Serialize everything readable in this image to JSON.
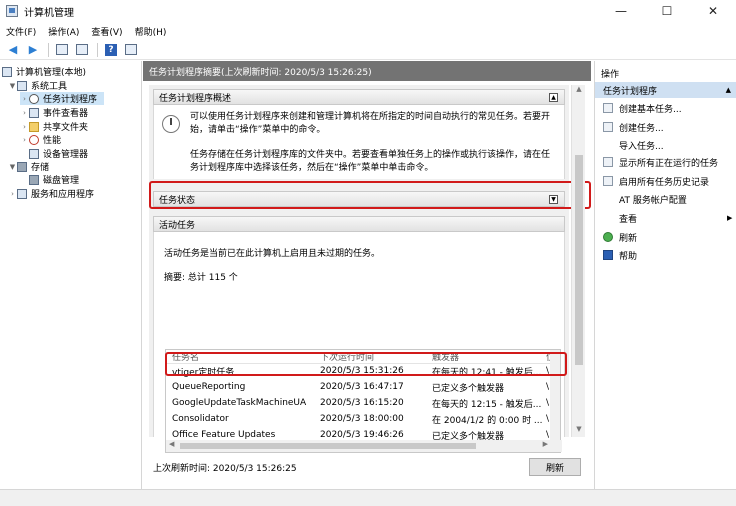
{
  "window": {
    "title": "计算机管理",
    "min": "—",
    "max": "☐",
    "close": "✕"
  },
  "menu": [
    "文件(F)",
    "操作(A)",
    "查看(V)",
    "帮助(H)"
  ],
  "toolbar": {
    "back": "◀",
    "forward": "▶"
  },
  "tree": {
    "root": "计算机管理(本地)",
    "system_tools": "系统工具",
    "task_scheduler": "任务计划程序",
    "event_viewer": "事件查看器",
    "shared_folders": "共享文件夹",
    "performance": "性能",
    "device_manager": "设备管理器",
    "storage": "存储",
    "disk_management": "磁盘管理",
    "services": "服务和应用程序"
  },
  "main": {
    "header": "任务计划程序摘要(上次刷新时间: 2020/5/3 15:26:25)",
    "overview_title": "任务计划程序概述",
    "overview_p1": "可以使用任务计划程序来创建和管理计算机将在所指定的时间自动执行的常见任务。若要开始，请单击“操作”菜单中的命令。",
    "overview_p2": "任务存储在任务计划程序库的文件夹中。若要查看单独任务上的操作或执行该操作，请在任务计划程序库中选择该任务，然后在“操作”菜单中单击命令。",
    "status_title": "任务状态",
    "active_title": "活动任务",
    "active_desc": "活动任务是当前已在此计算机上启用且未过期的任务。",
    "summary": "摘要: 总计 115 个",
    "columns": [
      "任务名",
      "下次运行时间",
      "触发器",
      "位"
    ],
    "rows": [
      [
        "vtiger定时任务",
        "2020/5/3 15:31:26",
        "在每天的 12:41 - 触发后...",
        "\\"
      ],
      [
        "QueueReporting",
        "2020/5/3 16:47:17",
        "已定义多个触发器",
        "\\"
      ],
      [
        "GoogleUpdateTaskMachineUA",
        "2020/5/3 16:15:20",
        "在每天的 12:15 - 触发后...",
        "\\"
      ],
      [
        "Consolidator",
        "2020/5/3 18:00:00",
        "在 2004/1/2 的 0:00 时 ...",
        "\\"
      ],
      [
        "Office Feature Updates",
        "2020/5/3 19:46:26",
        "已定义多个触发器",
        "\\"
      ]
    ],
    "last_refresh": "上次刷新时间: 2020/5/3 15:26:25",
    "refresh_button": "刷新"
  },
  "actions": {
    "title": "操作",
    "group": "任务计划程序",
    "items": [
      "创建基本任务...",
      "创建任务...",
      "导入任务...",
      "显示所有正在运行的任务",
      "启用所有任务历史记录",
      "AT 服务帐户配置",
      "查看",
      "刷新",
      "帮助"
    ]
  }
}
